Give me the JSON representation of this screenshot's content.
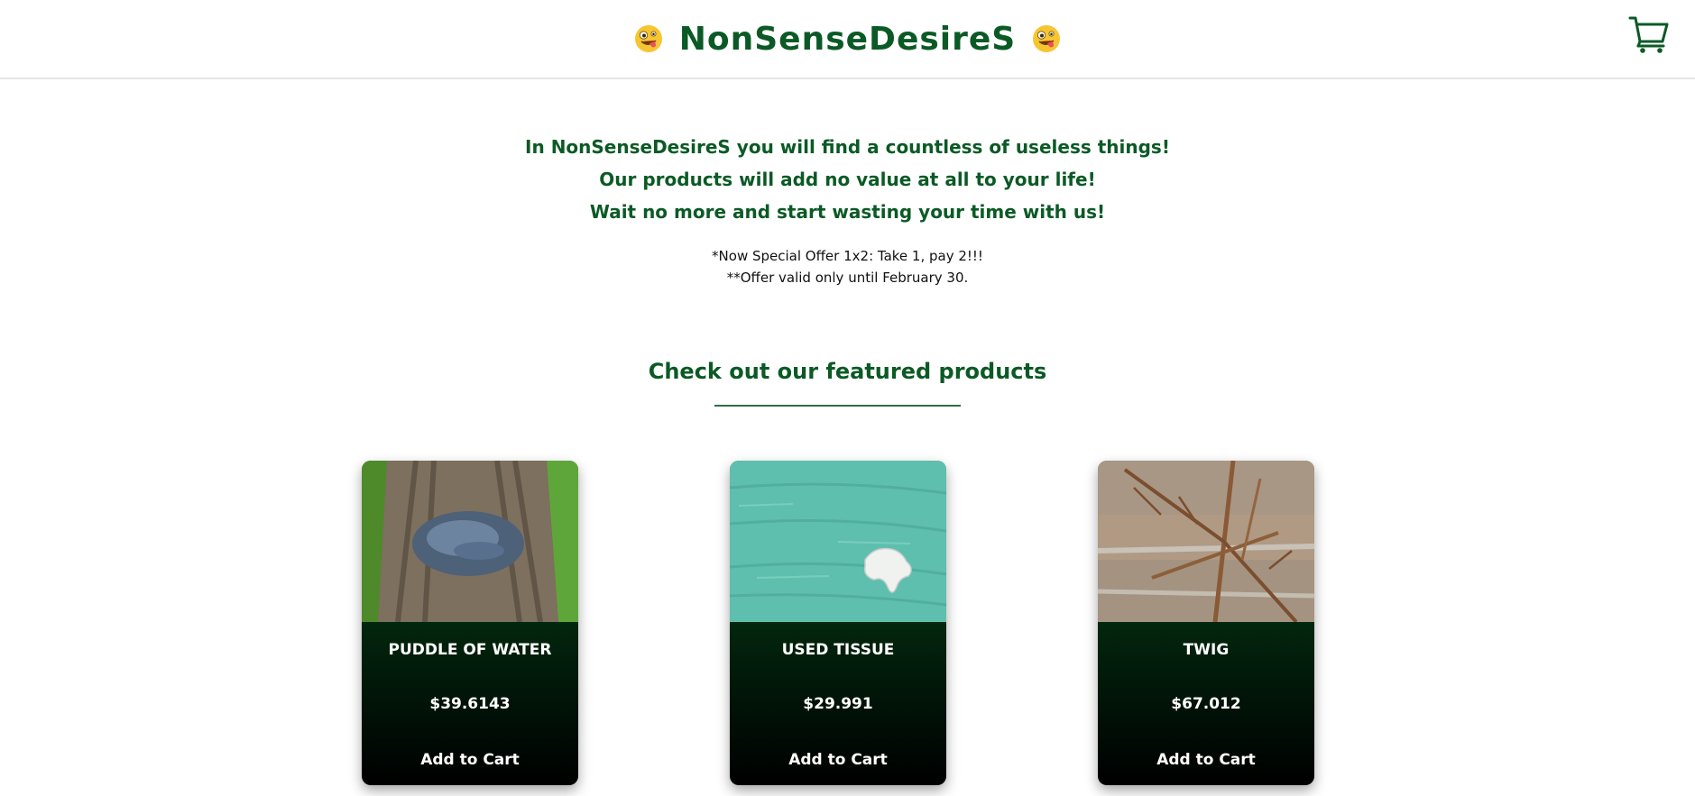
{
  "header": {
    "title": "NonSenseDesireS",
    "left_emoji": "zany-face-emoji",
    "right_emoji": "zany-face-emoji",
    "cart_icon": "shopping-cart-icon"
  },
  "intro": {
    "lines": [
      "In NonSenseDesireS you will find a countless of useless things!",
      "Our products will add no value at all to your life!",
      "Wait no more and start wasting your time with us!"
    ],
    "offer_lines": [
      "*Now Special Offer 1x2: Take 1, pay 2!!!",
      "**Offer valid only until February 30."
    ]
  },
  "featured": {
    "heading": "Check out our featured products"
  },
  "products": [
    {
      "name": "PUDDLE OF WATER",
      "price": "$39.6143",
      "button": "Add to Cart",
      "image": "puddle-photo"
    },
    {
      "name": "USED TISSUE",
      "price": "$29.991",
      "button": "Add to Cart",
      "image": "tissue-photo"
    },
    {
      "name": "TWIG",
      "price": "$67.012",
      "button": "Add to Cart",
      "image": "twig-photo"
    }
  ],
  "colors": {
    "brand_green": "#0b5a25",
    "card_top": "#044a1c",
    "card_bottom": "#000000"
  }
}
